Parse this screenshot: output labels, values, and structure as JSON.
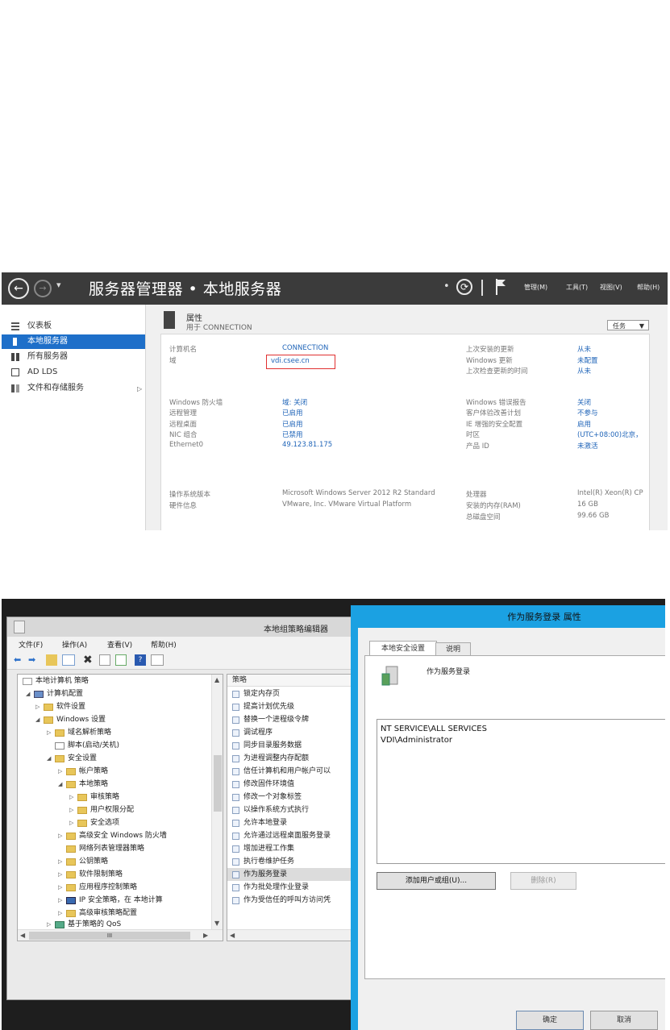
{
  "server_manager": {
    "title": "服务器管理器 • 本地服务器",
    "menus": [
      "管理(M)",
      "工具(T)",
      "视图(V)",
      "帮助(H)"
    ],
    "sidebar": [
      {
        "label": "仪表板"
      },
      {
        "label": "本地服务器"
      },
      {
        "label": "所有服务器"
      },
      {
        "label": "AD LDS"
      },
      {
        "label": "文件和存储服务"
      }
    ],
    "properties": {
      "title": "属性",
      "subtitle": "用于 CONNECTION",
      "tasks_label": "任务",
      "rows_left": [
        {
          "label": "计算机名",
          "value": "CONNECTION"
        },
        {
          "label": "域",
          "value": "vdi.csee.cn"
        },
        {
          "label": "Windows 防火墙",
          "value": "域: 关闭"
        },
        {
          "label": "远程管理",
          "value": "已启用"
        },
        {
          "label": "远程桌面",
          "value": "已启用"
        },
        {
          "label": "NIC 组合",
          "value": "已禁用"
        },
        {
          "label": "Ethernet0",
          "value": "49.123.81.175"
        },
        {
          "label": "操作系统版本",
          "value": "Microsoft Windows Server 2012 R2 Standard"
        },
        {
          "label": "硬件信息",
          "value": "VMware, Inc. VMware Virtual Platform"
        }
      ],
      "rows_right": [
        {
          "label": "上次安装的更新",
          "value": "从未"
        },
        {
          "label": "Windows 更新",
          "value": "未配置"
        },
        {
          "label": "上次检查更新的时间",
          "value": "从未"
        },
        {
          "label": "Windows 错误报告",
          "value": "关闭"
        },
        {
          "label": "客户体验改善计划",
          "value": "不参与"
        },
        {
          "label": "IE 增强的安全配置",
          "value": "启用"
        },
        {
          "label": "时区",
          "value": "(UTC+08:00)北京，"
        },
        {
          "label": "产品 ID",
          "value": "未激活"
        },
        {
          "label": "处理器",
          "value": "Intel(R) Xeon(R) CP"
        },
        {
          "label": "安装的内存(RAM)",
          "value": "16 GB"
        },
        {
          "label": "总磁盘空间",
          "value": "99.66 GB"
        }
      ]
    }
  },
  "gpedit": {
    "title": "本地组策略编辑器",
    "menus": [
      "文件(F)",
      "操作(A)",
      "查看(V)",
      "帮助(H)"
    ],
    "tree": [
      {
        "label": "本地计算机 策略"
      },
      {
        "label": "计算机配置"
      },
      {
        "label": "软件设置"
      },
      {
        "label": "Windows 设置"
      },
      {
        "label": "域名解析策略"
      },
      {
        "label": "脚本(启动/关机)"
      },
      {
        "label": "安全设置"
      },
      {
        "label": "帐户策略"
      },
      {
        "label": "本地策略"
      },
      {
        "label": "审核策略"
      },
      {
        "label": "用户权限分配"
      },
      {
        "label": "安全选项"
      },
      {
        "label": "高级安全 Windows 防火墙"
      },
      {
        "label": "网络列表管理器策略"
      },
      {
        "label": "公钥策略"
      },
      {
        "label": "软件限制策略"
      },
      {
        "label": "应用程序控制策略"
      },
      {
        "label": "IP 安全策略，在 本地计算"
      },
      {
        "label": "高级审核策略配置"
      },
      {
        "label": "基于策略的 QoS"
      }
    ],
    "list_header": "策略",
    "list": [
      {
        "label": "锁定内存页"
      },
      {
        "label": "提高计划优先级"
      },
      {
        "label": "替换一个进程级令牌"
      },
      {
        "label": "调试程序"
      },
      {
        "label": "同步目录服务数据"
      },
      {
        "label": "为进程调整内存配额"
      },
      {
        "label": "信任计算机和用户帐户可以"
      },
      {
        "label": "修改固件环境值"
      },
      {
        "label": "修改一个对象标签"
      },
      {
        "label": "以操作系统方式执行"
      },
      {
        "label": "允许本地登录"
      },
      {
        "label": "允许通过远程桌面服务登录"
      },
      {
        "label": "增加进程工作集"
      },
      {
        "label": "执行卷维护任务"
      },
      {
        "label": "作为服务登录"
      },
      {
        "label": "作为批处理作业登录"
      },
      {
        "label": "作为受信任的呼叫方访问凭"
      }
    ],
    "scroll_thumb": "III"
  },
  "dialog": {
    "title": "作为服务登录 属性",
    "tabs": [
      "本地安全设置",
      "说明"
    ],
    "policy_name": "作为服务登录",
    "accounts": [
      "NT SERVICE\\ALL SERVICES",
      "VDI\\Administrator"
    ],
    "add_button": "添加用户或组(U)...",
    "remove_button": "删除(R)",
    "ok_button": "确定",
    "cancel_button": "取消"
  }
}
